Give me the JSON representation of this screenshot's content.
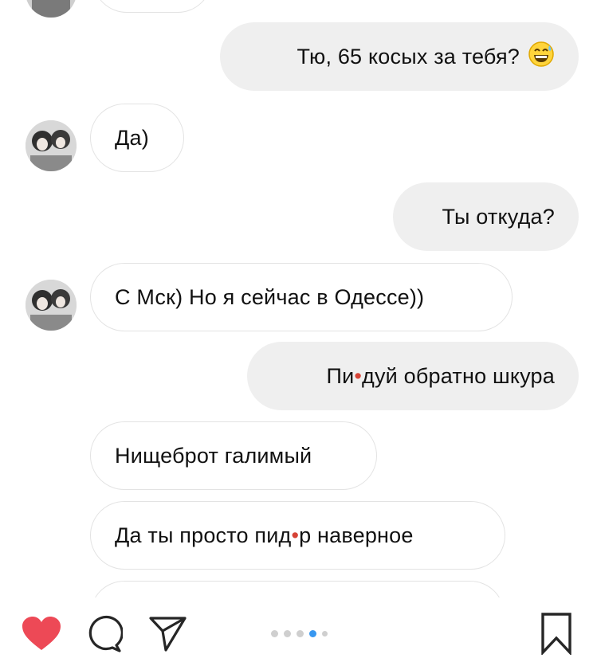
{
  "messages": [
    {
      "side": "out",
      "text": "Тю, 65 косых за тебя?",
      "emoji": "grinning-sweat-emoji"
    },
    {
      "side": "in",
      "text": "Да)"
    },
    {
      "side": "out",
      "text": "Ты откуда?"
    },
    {
      "side": "in",
      "text": "С Мск) Но я сейчас в Одессе))"
    },
    {
      "side": "out",
      "text_a": "Пи",
      "text_b": "дуй обратно шкура"
    },
    {
      "side": "in",
      "text": "Нищеброт галимый"
    },
    {
      "side": "in",
      "text_a": "Да ты просто пид",
      "text_b": "р наверное"
    }
  ],
  "actions": {
    "like_icon": "heart-icon",
    "comment_icon": "comment-icon",
    "share_icon": "share-icon",
    "save_icon": "bookmark-icon"
  },
  "carousel": {
    "count": 5,
    "active_index": 3
  },
  "colors": {
    "like": "#ed4956",
    "outgoing_bubble": "#efefef",
    "active_dot": "#3897f0",
    "censor_dot": "#d64336"
  }
}
